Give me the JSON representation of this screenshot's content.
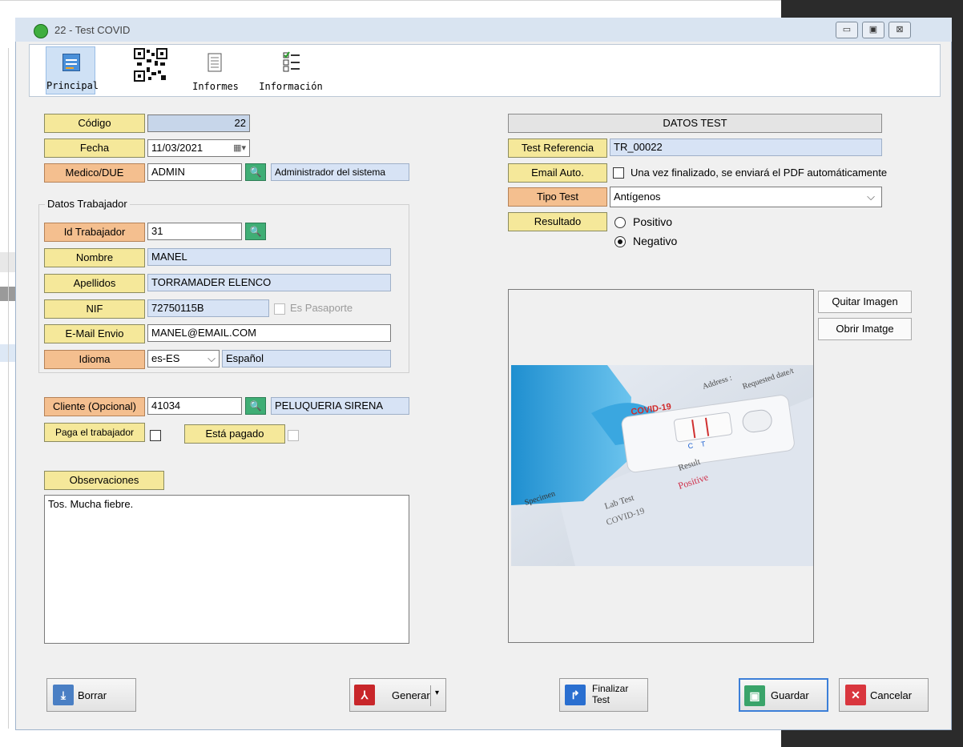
{
  "window": {
    "title": "22 - Test COVID",
    "minimize": "▭",
    "maximize": "▣",
    "close": "⊠"
  },
  "toolbar": {
    "principal": "Principal",
    "qr": "",
    "informes": "Informes",
    "informacion": "Información"
  },
  "form": {
    "codigo_label": "Código",
    "codigo_value": "22",
    "fecha_label": "Fecha",
    "fecha_value": "11/03/2021",
    "medico_label": "Medico/DUE",
    "medico_value": "ADMIN",
    "medico_desc": "Administrador del sistema",
    "datos_trabajador_title": "Datos Trabajador",
    "id_trabajador_label": "Id Trabajador",
    "id_trabajador_value": "31",
    "nombre_label": "Nombre",
    "nombre_value": "MANEL",
    "apellidos_label": "Apellidos",
    "apellidos_value": "TORRAMADER ELENCO",
    "nif_label": "NIF",
    "nif_value": "72750115B",
    "pasaporte_label": "Es Pasaporte",
    "email_label": "E-Mail Envio",
    "email_value": "MANEL@EMAIL.COM",
    "idioma_label": "Idioma",
    "idioma_value": "es-ES",
    "idioma_desc": "Español",
    "cliente_label": "Cliente (Opcional)",
    "cliente_value": "41034",
    "cliente_desc": "PELUQUERIA SIRENA",
    "paga_label": "Paga el trabajador",
    "pagado_label": "Está pagado",
    "observaciones_label": "Observaciones",
    "observaciones_value": "Tos. Mucha fiebre."
  },
  "test": {
    "header": "DATOS TEST",
    "referencia_label": "Test Referencia",
    "referencia_value": "TR_00022",
    "email_auto_label": "Email Auto.",
    "email_auto_text": "Una vez finalizado, se enviará el PDF automáticamente",
    "tipo_label": "Tipo Test",
    "tipo_value": "Antígenos",
    "resultado_label": "Resultado",
    "positivo": "Positivo",
    "negativo": "Negativo",
    "quitar_imagen": "Quitar Imagen",
    "obrir_imatge": "Obrir Imatge"
  },
  "photo": {
    "covid_text": "COVID-19",
    "positive_text": "Positive",
    "result_text": "Result",
    "lab_text": "Lab Test",
    "covid_lower": "COVID-19",
    "specimen_text": "Specimen",
    "address_text": "Address :",
    "requested_text": "Requested date/t"
  },
  "buttons": {
    "borrar": "Borrar",
    "generar": "Generar",
    "finalizar": "Finalizar Test",
    "guardar": "Guardar",
    "cancelar": "Cancelar"
  },
  "colors": {
    "label_yellow": "#f5e89a",
    "label_orange": "#f4bf8f",
    "readonly_blue": "#d7e3f5"
  }
}
